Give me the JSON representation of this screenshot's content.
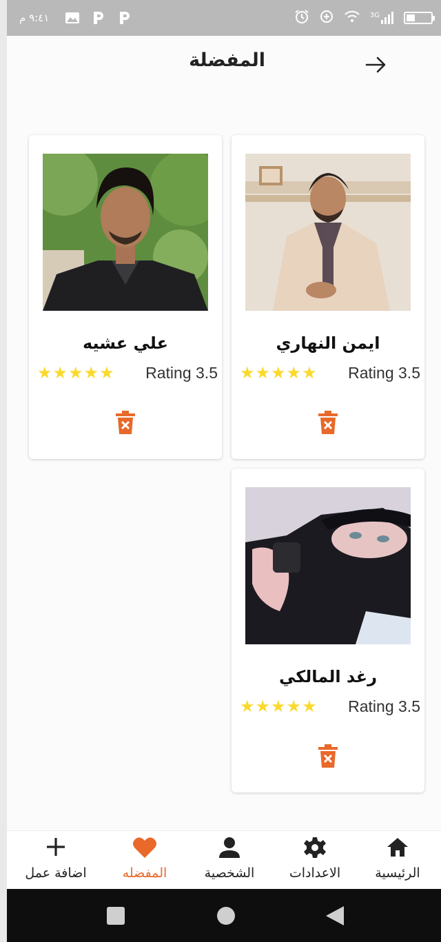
{
  "status_bar": {
    "time": "٩:٤١ م",
    "network": "3G"
  },
  "header": {
    "title": "المفضلة"
  },
  "favorites": [
    {
      "name": "ايمن النهاري",
      "rating_label": "Rating 3.5",
      "stars": 5
    },
    {
      "name": "علي عشيه",
      "rating_label": "Rating 3.5",
      "stars": 5
    },
    {
      "name": "رغد المالكي",
      "rating_label": "Rating 3.5",
      "stars": 5
    }
  ],
  "bottom_nav": {
    "items": [
      {
        "label": "الرئيسية",
        "icon": "home-icon"
      },
      {
        "label": "الاعدادات",
        "icon": "gear-icon"
      },
      {
        "label": "الشخصية",
        "icon": "person-icon"
      },
      {
        "label": "المفضله",
        "icon": "heart-icon",
        "active": true
      },
      {
        "label": "اضافة عمل",
        "icon": "plus-icon"
      }
    ]
  },
  "colors": {
    "accent": "#e8692a",
    "star": "#fbd92c",
    "status_bar": "#b9b9b9"
  }
}
